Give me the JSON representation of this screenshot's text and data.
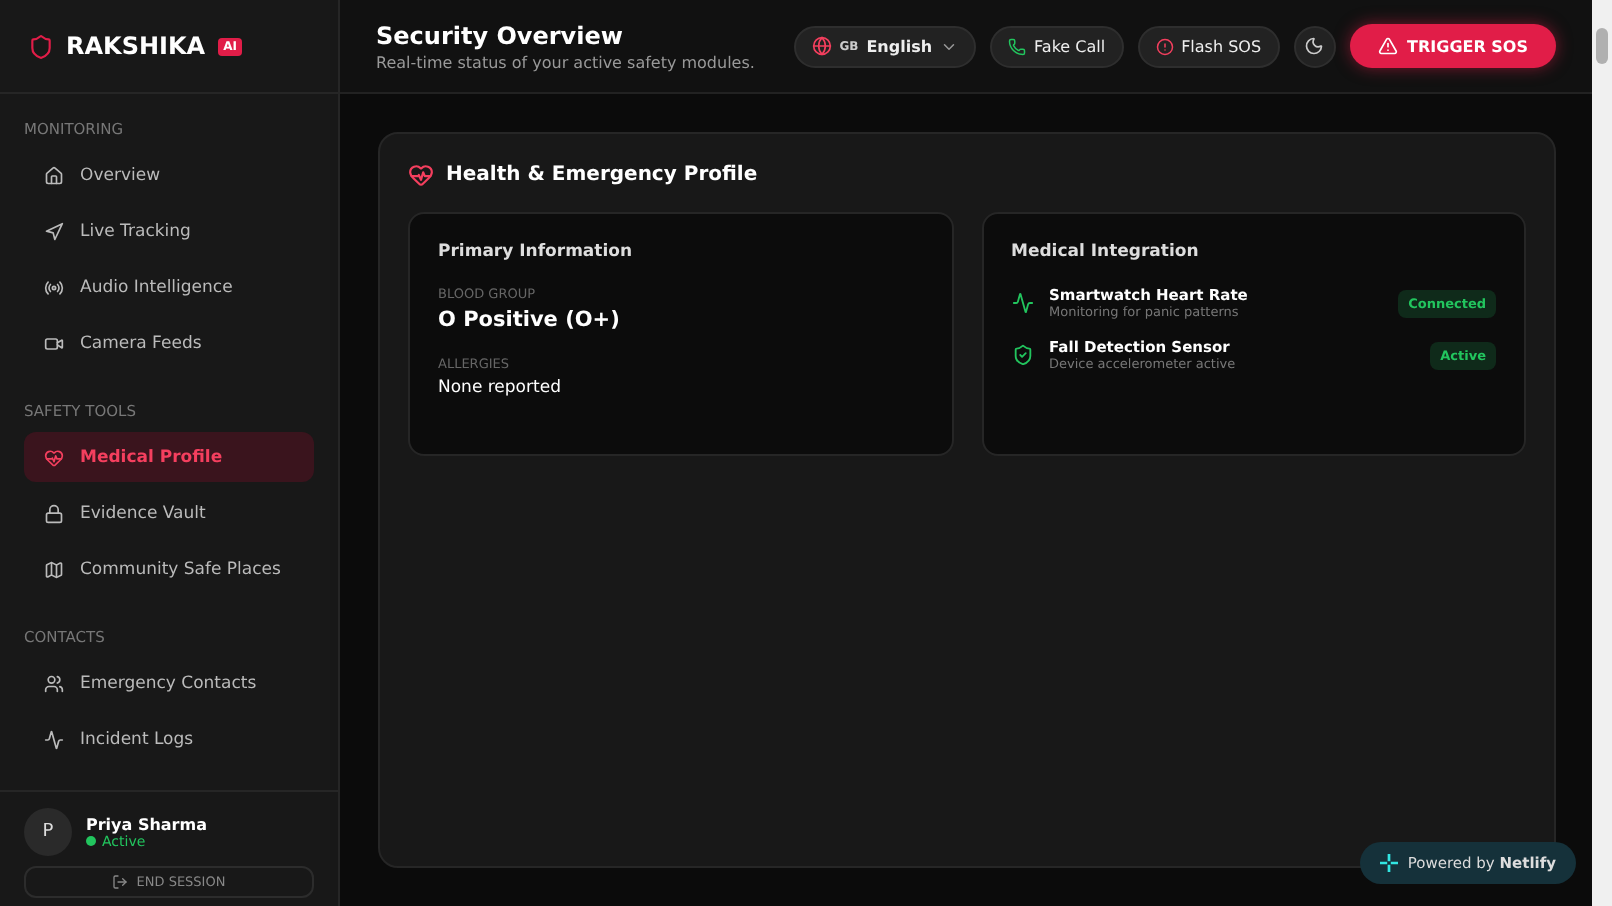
{
  "brand": {
    "name": "RAKSHIKA",
    "badge": "AI"
  },
  "sidebar": {
    "sections": [
      {
        "title": "MONITORING",
        "items": [
          {
            "label": "Overview",
            "selected": false
          },
          {
            "label": "Live Tracking",
            "selected": false
          },
          {
            "label": "Audio Intelligence",
            "selected": false
          },
          {
            "label": "Camera Feeds",
            "selected": false
          }
        ]
      },
      {
        "title": "SAFETY TOOLS",
        "items": [
          {
            "label": "Medical Profile",
            "selected": true
          },
          {
            "label": "Evidence Vault",
            "selected": false
          },
          {
            "label": "Community Safe Places",
            "selected": false
          }
        ]
      },
      {
        "title": "CONTACTS",
        "items": [
          {
            "label": "Emergency Contacts",
            "selected": false
          },
          {
            "label": "Incident Logs",
            "selected": false
          }
        ]
      }
    ],
    "user": {
      "initial": "P",
      "name": "Priya Sharma",
      "status": "Active"
    },
    "end_button": "END SESSION"
  },
  "header": {
    "title": "Security Overview",
    "subtitle": "Real-time status of your active safety modules.",
    "language": {
      "code": "GB",
      "label": "English"
    },
    "fake_call": "Fake Call",
    "flash_sos": "Flash SOS",
    "trigger": "TRIGGER SOS"
  },
  "panel": {
    "title": "Health & Emergency Profile",
    "primary": {
      "title": "Primary Information",
      "fields": [
        {
          "label": "BLOOD GROUP",
          "value": "O Positive (O+)",
          "kind": "large"
        },
        {
          "label": "ALLERGIES",
          "value": "None reported",
          "kind": "normal"
        }
      ]
    },
    "integration": {
      "title": "Medical Integration",
      "items": [
        {
          "name": "Smartwatch Heart Rate",
          "detail": "Monitoring for panic patterns",
          "status": "Connected"
        },
        {
          "name": "Fall Detection Sensor",
          "detail": "Device accelerometer active",
          "status": "Active"
        }
      ]
    }
  },
  "netlify": {
    "prefix": "Powered by",
    "name": "Netlify"
  }
}
